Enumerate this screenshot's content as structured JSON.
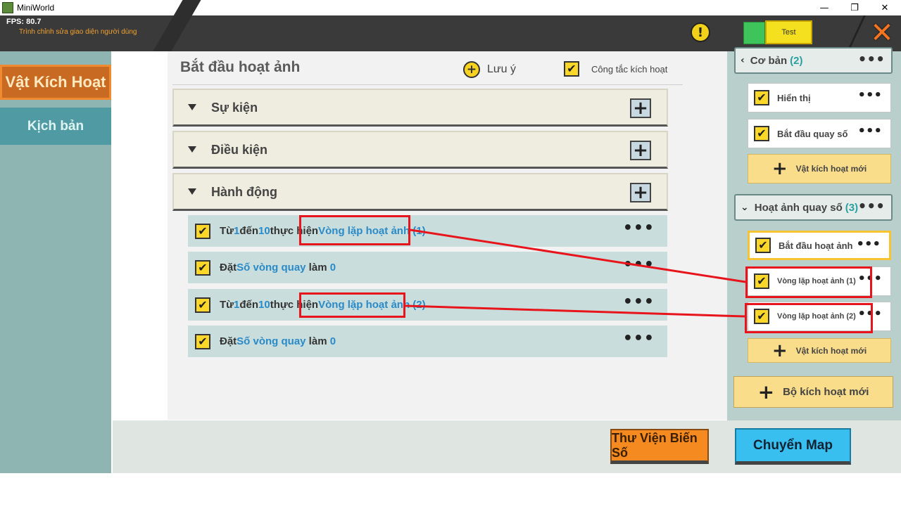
{
  "window": {
    "title": "MiniWorld",
    "minimize": "—",
    "maximize": "❐",
    "close": "✕"
  },
  "topbar": {
    "fps": "FPS: 80.7",
    "subtitle": "Trình chỉnh sửa giao diện người dùng",
    "warning_icon": "!",
    "test_label": "Test",
    "close_icon": "✕"
  },
  "left_tabs": [
    {
      "label": "Vật Kích Hoạt",
      "active": true
    },
    {
      "label": "Kịch bản",
      "active": false
    }
  ],
  "main": {
    "title": "Bắt đầu hoạt ảnh",
    "note_label": "Lưu ý",
    "switch_label": "Công tắc kích hoạt",
    "sections": [
      {
        "label": "Sự kiện"
      },
      {
        "label": "Điều kiện"
      },
      {
        "label": "Hành động"
      }
    ],
    "actions": [
      {
        "p1": "Từ",
        "v1": "1",
        "p2": "đến",
        "v2": "10",
        "p3": "thực hiện",
        "v3": "Vòng lặp hoạt ảnh (1)"
      },
      {
        "p1": "Đặt",
        "v1": "Số vòng quay",
        "p2": " làm ",
        "v2": "0",
        "p3": "",
        "v3": ""
      },
      {
        "p1": "Từ",
        "v1": "1",
        "p2": "đến",
        "v2": "10",
        "p3": "thực hiện",
        "v3": "Vòng lặp hoạt ảnh (2)"
      },
      {
        "p1": "Đặt",
        "v1": "Số vòng quay",
        "p2": " làm ",
        "v2": "0",
        "p3": "",
        "v3": ""
      }
    ],
    "dots": "•••"
  },
  "right": {
    "group1": {
      "title": "Cơ bản",
      "count": "(2)"
    },
    "group1_items": [
      "Hiển thị",
      "Bắt đầu quay số"
    ],
    "new_trigger_label": "Vật kích hoạt mới",
    "group2": {
      "title": "Hoạt ảnh quay số",
      "count": "(3)"
    },
    "group2_items": [
      "Bắt đầu hoạt ảnh",
      "Vòng lặp hoạt ảnh (1)",
      "Vòng lặp hoạt ảnh (2)"
    ],
    "new_triggerset_label": "Bộ kích hoạt mới",
    "dots": "•••"
  },
  "bottom": {
    "library_button": "Thư Viện Biến Số",
    "switch_map_button": "Chuyển Map"
  },
  "colors": {
    "annotation_red": "#e8141c",
    "accent_blue": "#2a8ac8"
  }
}
